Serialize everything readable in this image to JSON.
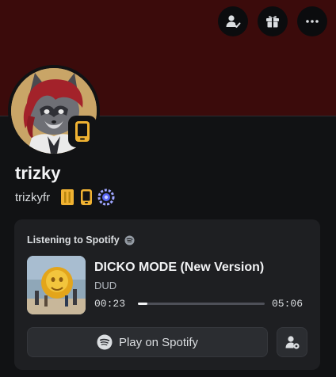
{
  "profile": {
    "display_name": "trizky",
    "username": "trizkyfr"
  },
  "header_actions": [
    {
      "icon": "add-friend-icon"
    },
    {
      "icon": "gift-icon"
    },
    {
      "icon": "more-icon"
    }
  ],
  "badges": [
    "nitro-badge-icon",
    "mobile-badge-icon",
    "boost-badge-icon"
  ],
  "activity": {
    "header": "Listening to Spotify",
    "track_title": "DICKO MODE (New Version)",
    "artist": "DUD",
    "elapsed": "00:23",
    "total": "05:06",
    "progress": 0.075,
    "play_label": "Play on Spotify"
  },
  "colors": {
    "banner": "#3b0b0b",
    "accent_badge": "#f0b232",
    "background": "#111214",
    "card": "#1e1f22"
  }
}
